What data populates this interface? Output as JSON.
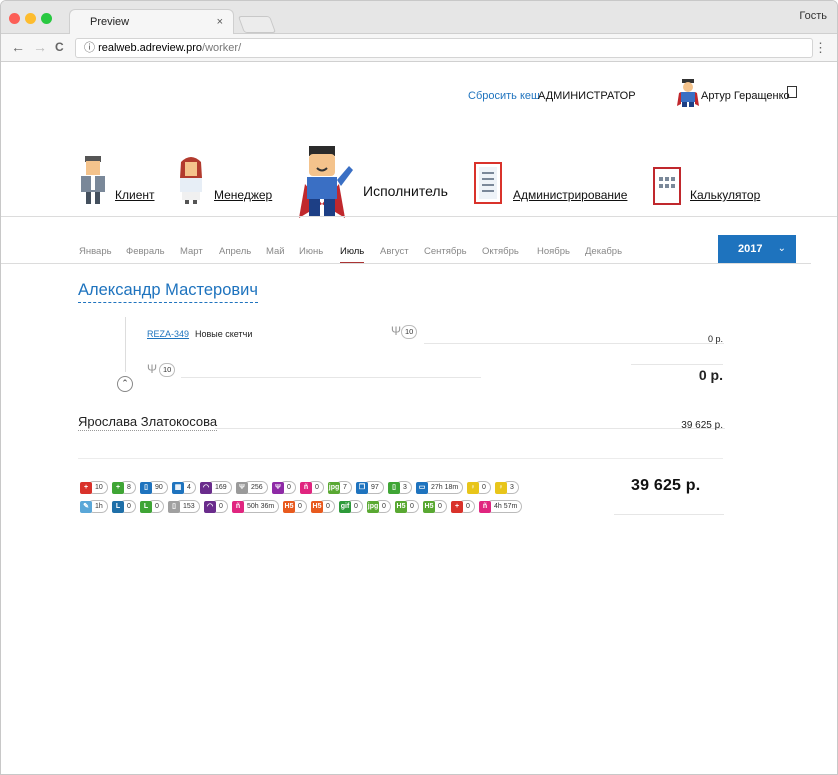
{
  "browser": {
    "tab_title": "Preview",
    "tab_close": "×",
    "profile": "Гость",
    "url_host": "realweb.adreview.pro",
    "url_path": "/worker/",
    "back": "←",
    "forward": "→",
    "reload": "C",
    "menu": "⋮",
    "info": "ⓘ"
  },
  "header": {
    "reset_cache": "Сбросить кеш",
    "role_badge": "АДМИНИСТРАТОР",
    "user_name": "Артур Геращенко"
  },
  "roles": [
    {
      "label": "Клиент"
    },
    {
      "label": "Менеджер"
    },
    {
      "label": "Исполнитель"
    },
    {
      "label": "Администрирование"
    },
    {
      "label": "Калькулятор"
    }
  ],
  "months": [
    "Январь",
    "Февраль",
    "Март",
    "Апрель",
    "Май",
    "Июнь",
    "Июль",
    "Август",
    "Сентябрь",
    "Октябрь",
    "Ноябрь",
    "Декабрь"
  ],
  "active_month": "Июль",
  "year": {
    "label": "2017",
    "chevron": "⌄"
  },
  "worker1": {
    "name": "Александр Мастерович",
    "task_id": "REZA-349",
    "task_title": "Новые скетчи",
    "task_hours": "10",
    "task_amount": "0 р.",
    "sum_hours": "10",
    "sum_amount": "0 р.",
    "collapse": "⌃"
  },
  "worker2": {
    "name": "Ярослава Златокосова",
    "amount": "39 625 р."
  },
  "stats_row1": [
    {
      "icon": "first-aid-red-icon",
      "value": "10",
      "color": "#d9322b",
      "glyph": "+"
    },
    {
      "icon": "first-aid-green-icon",
      "value": "8",
      "color": "#3fa535",
      "glyph": "+"
    },
    {
      "icon": "columns-blue-icon",
      "value": "90",
      "color": "#1e73be",
      "glyph": "▯"
    },
    {
      "icon": "grid-blue-icon",
      "value": "4",
      "color": "#1e73be",
      "glyph": "▦"
    },
    {
      "icon": "dome-purple-icon",
      "value": "169",
      "color": "#6a2c8c",
      "glyph": "◠"
    },
    {
      "icon": "tools-gray-icon",
      "value": "256",
      "color": "#9a9a9a",
      "glyph": "Ψ"
    },
    {
      "icon": "tools-purple-icon",
      "value": "0",
      "color": "#8e2aa6",
      "glyph": "Ψ"
    },
    {
      "icon": "workers-pink-icon",
      "value": "0",
      "color": "#e0257f",
      "glyph": "ñ"
    },
    {
      "icon": "jpg-green-icon",
      "value": "7",
      "color": "#59a832",
      "glyph": "jpg"
    },
    {
      "icon": "screens-blue-icon",
      "value": "97",
      "color": "#1e73be",
      "glyph": "❐"
    },
    {
      "icon": "columns-green-icon",
      "value": "3",
      "color": "#3fa535",
      "glyph": "▯"
    },
    {
      "icon": "monitor-blue-icon",
      "value": "27h 18m",
      "color": "#1e73be",
      "glyph": "▭"
    },
    {
      "icon": "bulb-yellow-icon",
      "value": "0",
      "color": "#e8c51a",
      "glyph": "♀"
    },
    {
      "icon": "bulb-yellow-icon",
      "value": "3",
      "color": "#e8c51a",
      "glyph": "♀"
    }
  ],
  "stats_row2": [
    {
      "icon": "pencil-blue-icon",
      "value": "1h",
      "color": "#5aa7d8",
      "glyph": "✎"
    },
    {
      "icon": "l-blue-icon",
      "value": "0",
      "color": "#1f6fa8",
      "glyph": "L"
    },
    {
      "icon": "l-green-icon",
      "value": "0",
      "color": "#3fa535",
      "glyph": "L"
    },
    {
      "icon": "columns-gray-icon",
      "value": "153",
      "color": "#a0a0a0",
      "glyph": "▯"
    },
    {
      "icon": "dome-purple-icon",
      "value": "0",
      "color": "#6a2c8c",
      "glyph": "◠"
    },
    {
      "icon": "workers-pink-icon",
      "value": "50h 36m",
      "color": "#e0257f",
      "glyph": "ñ"
    },
    {
      "icon": "h5-orange-icon",
      "value": "0",
      "color": "#e85a1e",
      "glyph": "H5"
    },
    {
      "icon": "h5-lite-orange-icon",
      "value": "0",
      "color": "#e85a1e",
      "glyph": "H5"
    },
    {
      "icon": "gif-green-icon",
      "value": "0",
      "color": "#2d9a3a",
      "glyph": "gif"
    },
    {
      "icon": "jpg-lite-green-icon",
      "value": "0",
      "color": "#59a832",
      "glyph": "jpg"
    },
    {
      "icon": "h5-green-icon",
      "value": "0",
      "color": "#59a832",
      "glyph": "H5"
    },
    {
      "icon": "h5-lite-green-icon",
      "value": "0",
      "color": "#59a832",
      "glyph": "H5"
    },
    {
      "icon": "first-aid-red-icon",
      "value": "0",
      "color": "#d9322b",
      "glyph": "+"
    },
    {
      "icon": "workers-pink-icon",
      "value": "4h 57m",
      "color": "#e0257f",
      "glyph": "ñ"
    }
  ],
  "total": "39 625 р."
}
